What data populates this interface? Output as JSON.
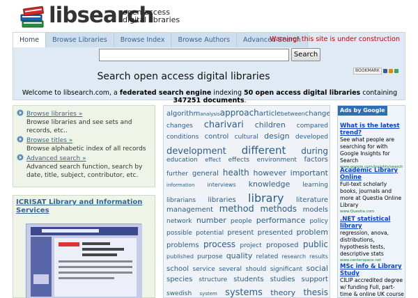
{
  "brand": {
    "name": "libsearch",
    "tagline_line1": "open access",
    "tagline_line2": "digital libraries"
  },
  "nav": {
    "tabs": [
      {
        "label": "Home",
        "active": true
      },
      {
        "label": "Browse Libraries",
        "active": false
      },
      {
        "label": "Browse Index",
        "active": false
      },
      {
        "label": "Browse Authors",
        "active": false
      },
      {
        "label": "Advanced Search",
        "active": false
      }
    ],
    "warning": "Warning! this site is under construction"
  },
  "search": {
    "value": "",
    "button_label": "Search"
  },
  "subtitle": "Search open access digital libraries",
  "bookmark_label": "BOOKMARK",
  "welcome": {
    "part1": "Welcome to libsearch.com, a ",
    "part2": "federated search engine",
    "part3": " indexing ",
    "part4": "50 open access digital libraries",
    "part5": " containing ",
    "part6": "347251 documents",
    "part7": "."
  },
  "left_panel": {
    "items": [
      {
        "link": "Browse libraries »",
        "desc": "Browse libraries and see sets and records, etc.."
      },
      {
        "link": "Browse titles »",
        "desc": "Browse alphabetic index of all records"
      },
      {
        "link": "Advanced search »",
        "desc": "Advanced search function, search by date, title, subject, contributor, etc."
      }
    ]
  },
  "featured": {
    "title": "ICRISAT Library and Information Services"
  },
  "tag_cloud": {
    "rows": [
      [
        {
          "t": "algorithm",
          "s": 10
        },
        {
          "t": "analysis",
          "s": 7
        },
        {
          "t": "approach",
          "s": 12
        },
        {
          "t": "article",
          "s": 10
        },
        {
          "t": "between",
          "s": 8
        },
        {
          "t": "change",
          "s": 10
        }
      ],
      [
        {
          "t": "changes",
          "s": 9
        },
        {
          "t": "charivari",
          "s": 13
        },
        {
          "t": "children",
          "s": 11
        },
        {
          "t": "compared",
          "s": 9
        }
      ],
      [
        {
          "t": "conditions",
          "s": 9
        },
        {
          "t": "control",
          "s": 10
        },
        {
          "t": "cultural",
          "s": 9
        },
        {
          "t": "design",
          "s": 11
        },
        {
          "t": "developed",
          "s": 9
        }
      ],
      [
        {
          "t": "development",
          "s": 13
        },
        {
          "t": "different",
          "s": 15
        },
        {
          "t": "during",
          "s": 12
        }
      ],
      [
        {
          "t": "education",
          "s": 9
        },
        {
          "t": "effect",
          "s": 8
        },
        {
          "t": "effects",
          "s": 9
        },
        {
          "t": "environment",
          "s": 9
        },
        {
          "t": "factors",
          "s": 10
        }
      ],
      [
        {
          "t": "further",
          "s": 9
        },
        {
          "t": "general",
          "s": 10
        },
        {
          "t": "health",
          "s": 12
        },
        {
          "t": "however",
          "s": 11
        },
        {
          "t": "important",
          "s": 11
        }
      ],
      [
        {
          "t": "information",
          "s": 7
        },
        {
          "t": "interviews",
          "s": 8
        },
        {
          "t": "knowledge",
          "s": 11
        },
        {
          "t": "learning",
          "s": 9
        }
      ],
      [
        {
          "t": "librarians",
          "s": 9
        },
        {
          "t": "libraries",
          "s": 10
        },
        {
          "t": "library",
          "s": 16
        },
        {
          "t": "literature",
          "s": 10
        }
      ],
      [
        {
          "t": "management",
          "s": 10
        },
        {
          "t": "method",
          "s": 13
        },
        {
          "t": "methods",
          "s": 12
        },
        {
          "t": "models",
          "s": 10
        }
      ],
      [
        {
          "t": "network",
          "s": 9
        },
        {
          "t": "number",
          "s": 11
        },
        {
          "t": "people",
          "s": 9
        },
        {
          "t": "performance",
          "s": 11
        },
        {
          "t": "policy",
          "s": 9
        }
      ],
      [
        {
          "t": "possible",
          "s": 9
        },
        {
          "t": "potential",
          "s": 9
        },
        {
          "t": "present",
          "s": 10
        },
        {
          "t": "presented",
          "s": 10
        },
        {
          "t": "problem",
          "s": 11
        }
      ],
      [
        {
          "t": "problems",
          "s": 10
        },
        {
          "t": "process",
          "s": 12
        },
        {
          "t": "project",
          "s": 9
        },
        {
          "t": "proposed",
          "s": 10
        },
        {
          "t": "public",
          "s": 12
        }
      ],
      [
        {
          "t": "published",
          "s": 8
        },
        {
          "t": "purpose",
          "s": 9
        },
        {
          "t": "quality",
          "s": 11
        },
        {
          "t": "related",
          "s": 9
        },
        {
          "t": "research",
          "s": 8
        },
        {
          "t": "results",
          "s": 8
        }
      ],
      [
        {
          "t": "school",
          "s": 10
        },
        {
          "t": "service",
          "s": 9
        },
        {
          "t": "several",
          "s": 9
        },
        {
          "t": "should",
          "s": 9
        },
        {
          "t": "significant",
          "s": 9
        },
        {
          "t": "social",
          "s": 11
        }
      ],
      [
        {
          "t": "species",
          "s": 10
        },
        {
          "t": "structure",
          "s": 9
        },
        {
          "t": "students",
          "s": 10
        },
        {
          "t": "studies",
          "s": 10
        },
        {
          "t": "support",
          "s": 10
        }
      ],
      [
        {
          "t": "swedish",
          "s": 9
        },
        {
          "t": "system",
          "s": 7
        },
        {
          "t": "systems",
          "s": 13
        },
        {
          "t": "theory",
          "s": 11
        },
        {
          "t": "thesis",
          "s": 12
        }
      ]
    ]
  },
  "ads": {
    "header": "Ads by Google",
    "items": [
      {
        "title": "What is the latest trend?",
        "text": "See what people are searching for with Google Insights for Search",
        "url": "www.google.com/insights/search"
      },
      {
        "title": "Academic Library Online",
        "text": "Full-text scholarly books, journals and more at Questia Online Library",
        "url": "www.Questia.com"
      },
      {
        "title": ".NET statistical library",
        "text": "regression, anova, distributions, hypothesis tests, descriptive stats",
        "url": "www.centerspace.net"
      },
      {
        "title": "MSc info & Library Study",
        "text": "CILIP accredited degree w/ funding Full, part-time & online UK course",
        "url": ""
      }
    ]
  },
  "colors": {
    "nav_bg": "#dfeaf4",
    "link": "#37648f",
    "warning": "#c00000",
    "left_bg": "#eef4e7",
    "cloud_bg": "#eff3f8",
    "ad_link": "#0d3fd0"
  }
}
